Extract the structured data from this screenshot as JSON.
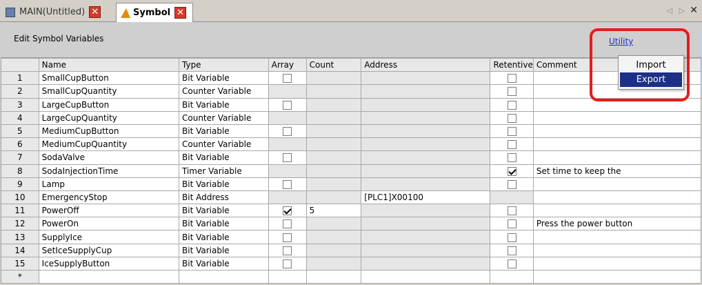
{
  "tabs": [
    {
      "label": "MAIN(Untitled)",
      "active": false
    },
    {
      "label": "Symbol",
      "active": true
    }
  ],
  "tab_close_glyph": "✕",
  "tab_scroll_glyph": "◁ ▷",
  "window_close_glyph": "✕",
  "panel": {
    "title": "Edit Symbol Variables",
    "utility_label": "Utility"
  },
  "menu": {
    "items": [
      "Import",
      "Export"
    ],
    "selected": "Export"
  },
  "table": {
    "columns": [
      "",
      "Name",
      "Type",
      "Array",
      "Count",
      "Address",
      "Retentive",
      "Comment"
    ],
    "rows": [
      {
        "num": "1",
        "name": "SmallCupButton",
        "type": "Bit Variable",
        "array": "off",
        "count": "",
        "address": "",
        "retentive": true,
        "retentive_checked": false,
        "comment": ""
      },
      {
        "num": "2",
        "name": "SmallCupQuantity",
        "type": "Counter Variable",
        "array": "none",
        "count": "",
        "address": "",
        "retentive": true,
        "retentive_checked": false,
        "comment": ""
      },
      {
        "num": "3",
        "name": "LargeCupButton",
        "type": "Bit Variable",
        "array": "off",
        "count": "",
        "address": "",
        "retentive": true,
        "retentive_checked": false,
        "comment": ""
      },
      {
        "num": "4",
        "name": "LargeCupQuantity",
        "type": "Counter Variable",
        "array": "none",
        "count": "",
        "address": "",
        "retentive": true,
        "retentive_checked": false,
        "comment": ""
      },
      {
        "num": "5",
        "name": "MediumCupButton",
        "type": "Bit Variable",
        "array": "off",
        "count": "",
        "address": "",
        "retentive": true,
        "retentive_checked": false,
        "comment": ""
      },
      {
        "num": "6",
        "name": "MediumCupQuantity",
        "type": "Counter Variable",
        "array": "none",
        "count": "",
        "address": "",
        "retentive": true,
        "retentive_checked": false,
        "comment": ""
      },
      {
        "num": "7",
        "name": "SodaValve",
        "type": "Bit Variable",
        "array": "off",
        "count": "",
        "address": "",
        "retentive": true,
        "retentive_checked": false,
        "comment": ""
      },
      {
        "num": "8",
        "name": "SodaInjectionTime",
        "type": "Timer Variable",
        "array": "none",
        "count": "",
        "address": "",
        "retentive": true,
        "retentive_checked": true,
        "comment": "Set time to keep the"
      },
      {
        "num": "9",
        "name": "Lamp",
        "type": "Bit Variable",
        "array": "off",
        "count": "",
        "address": "",
        "retentive": true,
        "retentive_checked": false,
        "comment": ""
      },
      {
        "num": "10",
        "name": "EmergencyStop",
        "type": "Bit Address",
        "array": "none",
        "count": "",
        "address": "[PLC1]X00100",
        "retentive": false,
        "retentive_checked": false,
        "comment": ""
      },
      {
        "num": "11",
        "name": "PowerOff",
        "type": "Bit Variable",
        "array": "on",
        "count": "5",
        "address": "",
        "retentive": true,
        "retentive_checked": false,
        "comment": ""
      },
      {
        "num": "12",
        "name": "PowerOn",
        "type": "Bit Variable",
        "array": "off",
        "count": "",
        "address": "",
        "retentive": true,
        "retentive_checked": false,
        "comment": "Press the power button"
      },
      {
        "num": "13",
        "name": "SupplyIce",
        "type": "Bit Variable",
        "array": "off",
        "count": "",
        "address": "",
        "retentive": true,
        "retentive_checked": false,
        "comment": ""
      },
      {
        "num": "14",
        "name": "SetIceSupplyCup",
        "type": "Bit Variable",
        "array": "off",
        "count": "",
        "address": "",
        "retentive": true,
        "retentive_checked": false,
        "comment": ""
      },
      {
        "num": "15",
        "name": "IceSupplyButton",
        "type": "Bit Variable",
        "array": "off",
        "count": "",
        "address": "",
        "retentive": true,
        "retentive_checked": false,
        "comment": ""
      }
    ],
    "new_row_marker": "*"
  },
  "colors": {
    "menu_highlight": "#1e2f87",
    "callout_border": "#e41c1c",
    "link": "#1a2fcc",
    "tab_close": "#d63a2a"
  }
}
